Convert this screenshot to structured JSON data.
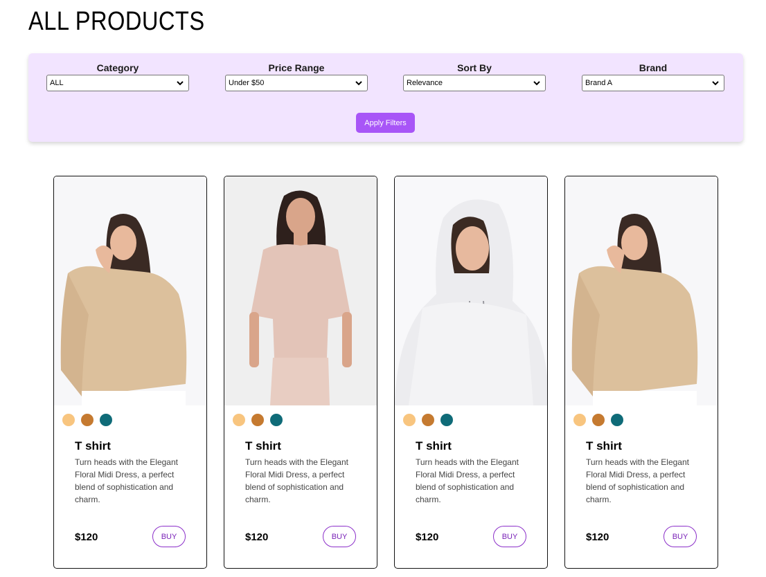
{
  "page": {
    "title": "ALL PRODUCTS"
  },
  "filters": {
    "category": {
      "label": "Category",
      "value": "ALL"
    },
    "price_range": {
      "label": "Price Range",
      "value": "Under $50"
    },
    "sort_by": {
      "label": "Sort By",
      "value": "Relevance"
    },
    "brand": {
      "label": "Brand",
      "value": "Brand A"
    },
    "apply_label": "Apply Filters"
  },
  "swatch_colors": [
    "#f8c57f",
    "#c57a30",
    "#0f6b78"
  ],
  "products": [
    {
      "name": "T shirt",
      "description": "Turn heads with the Elegant Floral Midi Dress, a perfect blend of sophistication and charm.",
      "price": "$120",
      "buy_label": "BUY",
      "image": "woman-beige-sweatshirt"
    },
    {
      "name": "T shirt",
      "description": "Turn heads with the Elegant Floral Midi Dress, a perfect blend of sophistication and charm.",
      "price": "$120",
      "buy_label": "BUY",
      "image": "woman-pink-tunic-set"
    },
    {
      "name": "T shirt",
      "description": "Turn heads with the Elegant Floral Midi Dress, a perfect blend of sophistication and charm.",
      "price": "$120",
      "buy_label": "BUY",
      "image": "woman-white-hoodie"
    },
    {
      "name": "T shirt",
      "description": "Turn heads with the Elegant Floral Midi Dress, a perfect blend of sophistication and charm.",
      "price": "$120",
      "buy_label": "BUY",
      "image": "woman-beige-sweatshirt"
    }
  ]
}
